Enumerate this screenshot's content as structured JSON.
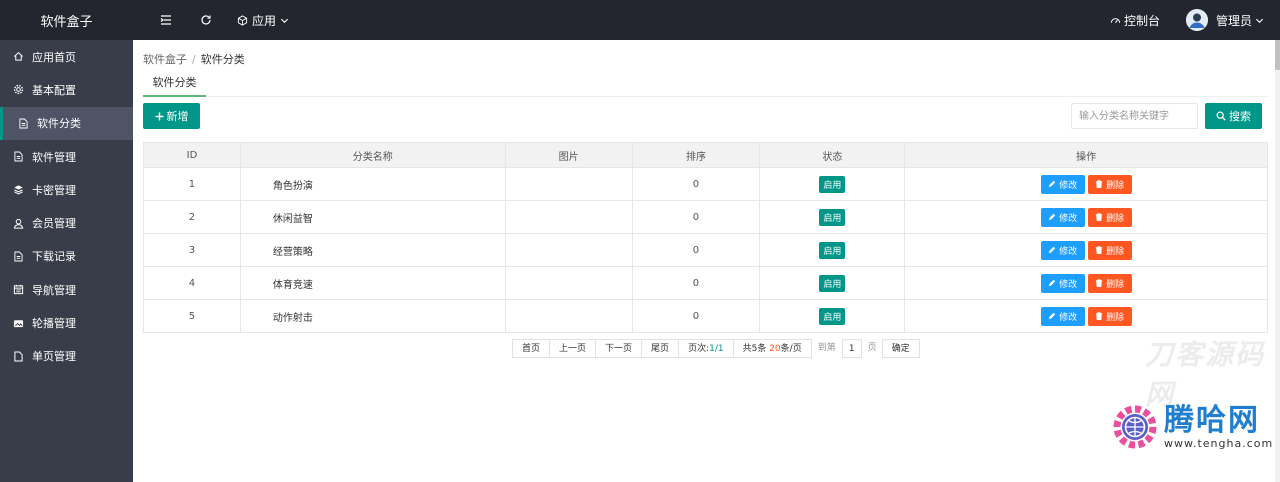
{
  "topbar": {
    "brand": "软件盒子",
    "app_menu": "应用",
    "console": "控制台",
    "user": "管理员"
  },
  "sidebar": {
    "items": [
      {
        "label": "应用首页",
        "icon": "home-icon"
      },
      {
        "label": "基本配置",
        "icon": "gear-icon"
      },
      {
        "label": "软件分类",
        "icon": "file-icon",
        "active": true
      },
      {
        "label": "软件管理",
        "icon": "file-icon"
      },
      {
        "label": "卡密管理",
        "icon": "layers-icon"
      },
      {
        "label": "会员管理",
        "icon": "user-icon"
      },
      {
        "label": "下载记录",
        "icon": "file-icon"
      },
      {
        "label": "导航管理",
        "icon": "calendar-icon"
      },
      {
        "label": "轮播管理",
        "icon": "image-icon"
      },
      {
        "label": "单页管理",
        "icon": "page-icon"
      }
    ]
  },
  "breadcrumb": {
    "root": "软件盒子",
    "sep": "/",
    "current": "软件分类"
  },
  "tab": {
    "label": "软件分类"
  },
  "toolbar": {
    "add_label": "新增",
    "search_placeholder": "输入分类名称关键字",
    "search_label": "搜索"
  },
  "table": {
    "headers": [
      "ID",
      "分类名称",
      "图片",
      "排序",
      "状态",
      "操作"
    ],
    "rows": [
      {
        "id": "1",
        "name": "角色扮演",
        "image": "",
        "sort": "0",
        "status": "启用"
      },
      {
        "id": "2",
        "name": "休闲益智",
        "image": "",
        "sort": "0",
        "status": "启用"
      },
      {
        "id": "3",
        "name": "经营策略",
        "image": "",
        "sort": "0",
        "status": "启用"
      },
      {
        "id": "4",
        "name": "体育竞速",
        "image": "",
        "sort": "0",
        "status": "启用"
      },
      {
        "id": "5",
        "name": "动作射击",
        "image": "",
        "sort": "0",
        "status": "启用"
      }
    ],
    "edit_label": "修改",
    "delete_label": "删除"
  },
  "pager": {
    "first": "首页",
    "prev": "上一页",
    "next": "下一页",
    "last": "尾页",
    "page_label": "页次:",
    "page_value": "1/1",
    "total_prefix": "共5条",
    "per_page_value": "20",
    "per_page_suffix": "条/页",
    "goto_label": "到第",
    "goto_value": "1",
    "page_unit": "页",
    "confirm": "确定"
  },
  "watermark": {
    "title": "腾哈网",
    "url": "www.tengha.com",
    "mid": "刀客源码网"
  },
  "colors": {
    "topbar": "#23262e",
    "sidebar": "#393d49",
    "primary": "#009688",
    "edit": "#1e9fff",
    "delete": "#ff5722"
  }
}
